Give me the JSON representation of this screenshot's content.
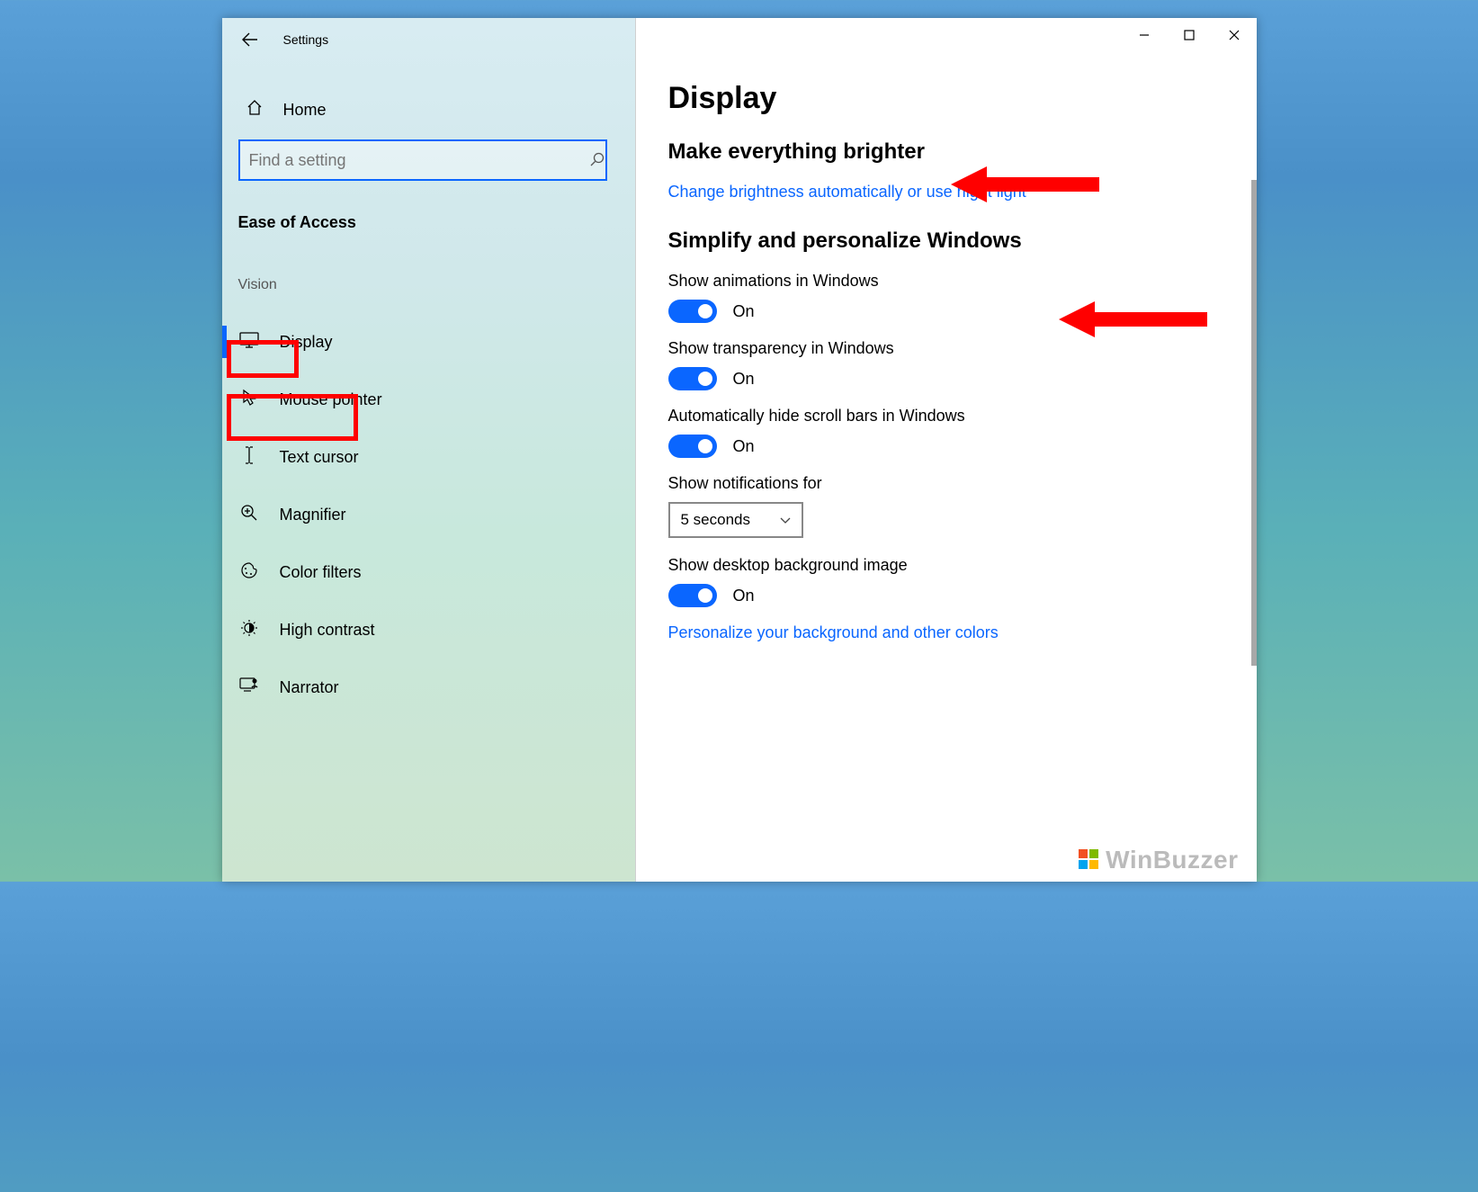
{
  "window": {
    "title": "Settings"
  },
  "sidebar": {
    "home_label": "Home",
    "search_placeholder": "Find a setting",
    "category_title": "Ease of Access",
    "group_title": "Vision",
    "items": [
      {
        "label": "Display",
        "icon": "display-icon"
      },
      {
        "label": "Mouse pointer",
        "icon": "mouse-pointer-icon"
      },
      {
        "label": "Text cursor",
        "icon": "text-cursor-icon"
      },
      {
        "label": "Magnifier",
        "icon": "magnifier-icon"
      },
      {
        "label": "Color filters",
        "icon": "palette-icon"
      },
      {
        "label": "High contrast",
        "icon": "high-contrast-icon"
      },
      {
        "label": "Narrator",
        "icon": "narrator-icon"
      }
    ]
  },
  "main": {
    "page_title": "Display",
    "section1_heading": "Make everything brighter",
    "brightness_link": "Change brightness automatically or use night light",
    "section2_heading": "Simplify and personalize Windows",
    "settings": {
      "animations_label": "Show animations in Windows",
      "animations_state": "On",
      "transparency_label": "Show transparency in Windows",
      "transparency_state": "On",
      "scrollbars_label": "Automatically hide scroll bars in Windows",
      "scrollbars_state": "On",
      "notifications_label": "Show notifications for",
      "notifications_value": "5 seconds",
      "desktop_bg_label": "Show desktop background image",
      "desktop_bg_state": "On"
    },
    "personalize_link": "Personalize your background and other colors"
  },
  "watermark": "WinBuzzer"
}
